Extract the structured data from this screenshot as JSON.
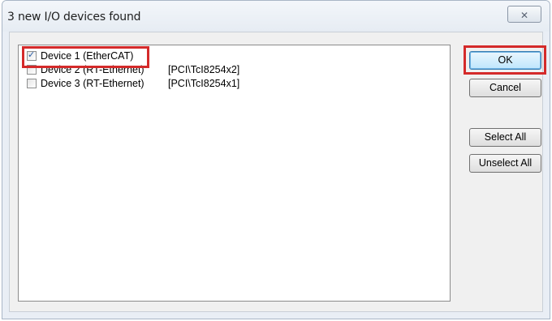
{
  "window": {
    "title": "3 new I/O devices found",
    "close_icon": "close-icon"
  },
  "devices": [
    {
      "name": "Device 1 (EtherCAT)",
      "path": "",
      "checked": true
    },
    {
      "name": "Device 2 (RT-Ethernet)",
      "path": "[PCI\\TcI8254x2]",
      "checked": false
    },
    {
      "name": "Device 3 (RT-Ethernet)",
      "path": "[PCI\\TcI8254x1]",
      "checked": false
    }
  ],
  "buttons": {
    "ok": "OK",
    "cancel": "Cancel",
    "select_all": "Select All",
    "unselect_all": "Unselect All"
  },
  "highlight_color": "#d42a2a"
}
